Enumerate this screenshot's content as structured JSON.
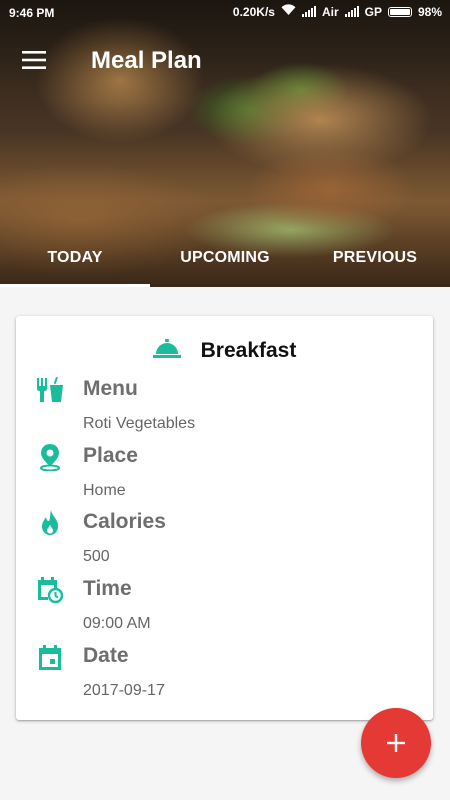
{
  "status_bar": {
    "time": "9:46 PM",
    "speed": "0.20K/s",
    "carrier1": "Air",
    "carrier2": "GP",
    "battery": "98%"
  },
  "toolbar": {
    "title": "Meal Plan",
    "menu_icon": "hamburger-menu-icon"
  },
  "tabs": [
    {
      "label": "TODAY",
      "active": true
    },
    {
      "label": "UPCOMING",
      "active": false
    },
    {
      "label": "PREVIOUS",
      "active": false
    }
  ],
  "meal_card": {
    "title": "Breakfast",
    "title_icon": "cloche-icon",
    "rows": [
      {
        "icon": "utensils-drink-icon",
        "label": "Menu",
        "value": "Roti Vegetables"
      },
      {
        "icon": "location-pin-icon",
        "label": "Place",
        "value": "Home"
      },
      {
        "icon": "flame-icon",
        "label": "Calories",
        "value": "500"
      },
      {
        "icon": "calendar-clock-icon",
        "label": "Time",
        "value": "09:00 AM"
      },
      {
        "icon": "calendar-icon",
        "label": "Date",
        "value": "2017-09-17"
      }
    ]
  },
  "fab": {
    "icon": "plus-icon"
  },
  "colors": {
    "accent": "#1abc9c",
    "fab": "#e53935",
    "label_gray": "#6e6e6e",
    "value_gray": "#666666"
  }
}
